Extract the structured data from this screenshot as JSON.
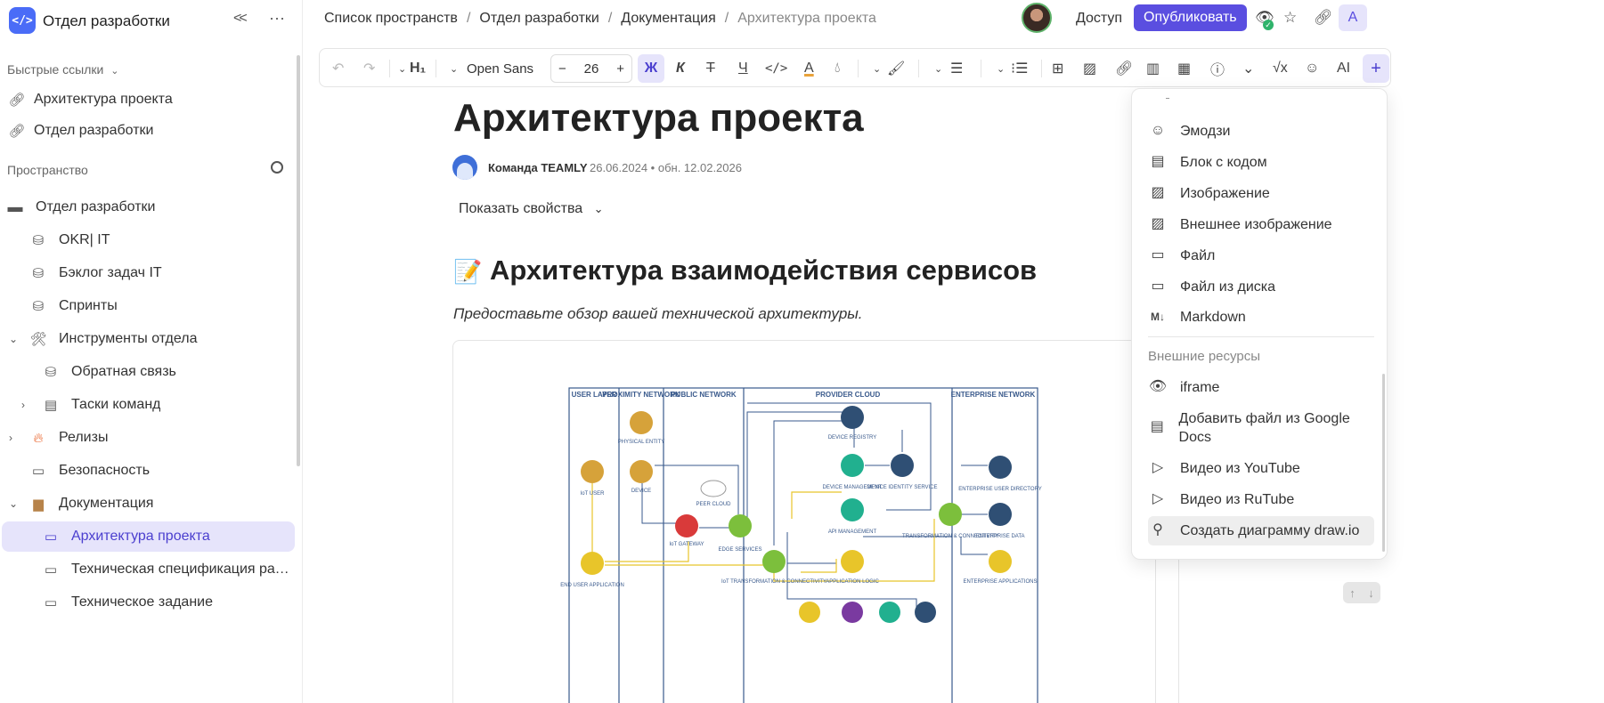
{
  "sidebar": {
    "workspace_title": "Отдел разработки",
    "logo_text": "</>",
    "quick_links_label": "Быстрые ссылки",
    "quick_links": [
      {
        "label": "Архитектура проекта",
        "icon": "link-icon"
      },
      {
        "label": "Отдел разработки",
        "icon": "link-icon"
      }
    ],
    "space_label": "Пространство",
    "tree": [
      {
        "label": "Отдел разработки",
        "icon": "folder-icon",
        "level": 0
      },
      {
        "label": "OKR| IT",
        "icon": "database-icon",
        "level": 1
      },
      {
        "label": "Бэклог задач IT",
        "icon": "database-icon",
        "level": 1
      },
      {
        "label": "Спринты",
        "icon": "database-icon",
        "level": 1
      },
      {
        "label": "Инструменты отдела",
        "icon": "tools-emoji",
        "level": 1,
        "expanded": true
      },
      {
        "label": "Обратная связь",
        "icon": "database-icon",
        "level": 2
      },
      {
        "label": "Таски команд",
        "icon": "page-emoji",
        "level": 2,
        "collapsed": true
      },
      {
        "label": "Релизы",
        "icon": "fire-emoji",
        "level": 1,
        "collapsed": true
      },
      {
        "label": "Безопасность",
        "icon": "document-icon",
        "level": 1
      },
      {
        "label": "Документация",
        "icon": "box-emoji",
        "level": 1,
        "expanded": true
      },
      {
        "label": "Архитектура проекта",
        "icon": "document-icon",
        "level": 2,
        "active": true
      },
      {
        "label": "Техническая спецификация разр...",
        "icon": "document-icon",
        "level": 2
      },
      {
        "label": "Техническое задание",
        "icon": "document-icon",
        "level": 2
      }
    ]
  },
  "topbar": {
    "breadcrumbs": [
      "Список пространств",
      "Отдел разработки",
      "Документация",
      "Архитектура проекта"
    ],
    "access_label": "Доступ",
    "publish_label": "Опубликовать",
    "user_initial": "A"
  },
  "toolbar": {
    "heading": "H₁",
    "font": "Open Sans",
    "font_size": "26",
    "bold": "Ж",
    "italic": "К",
    "strike": "Т",
    "underline": "Ч",
    "ai": "AI"
  },
  "document": {
    "title": "Архитектура проекта",
    "author": "Команда TEAMLY",
    "dates": "26.06.2024 • обн. 12.02.2026",
    "show_props": "Показать свойства",
    "heading": "Архитектура взаимодействия сервисов",
    "heading_emoji": "📝",
    "subtitle": "Предоставьте обзор вашей технической архитектуры."
  },
  "diagram": {
    "columns": [
      "USER LAYER",
      "PROXIMITY NETWORK",
      "PUBLIC NETWORK",
      "PROVIDER CLOUD",
      "ENTERPRISE NETWORK"
    ],
    "nodes": [
      {
        "id": "physical",
        "label": "PHYSICAL ENTITY",
        "color": "#d6a23a"
      },
      {
        "id": "iot_user",
        "label": "IoT USER",
        "color": "#d6a23a"
      },
      {
        "id": "device",
        "label": "DEVICE",
        "color": "#d6a23a"
      },
      {
        "id": "peer",
        "label": "PEER CLOUD",
        "color": "#ffffff"
      },
      {
        "id": "gateway",
        "label": "IoT GATEWAY",
        "color": "#d93a3a"
      },
      {
        "id": "edge",
        "label": "EDGE SERVICES",
        "color": "#7cbf3c"
      },
      {
        "id": "end_user",
        "label": "END USER APPLICATION",
        "color": "#e8c52a"
      },
      {
        "id": "device_reg",
        "label": "DEVICE REGISTRY",
        "color": "#2f4f74"
      },
      {
        "id": "device_mgmt",
        "label": "DEVICE MANAGEMENT",
        "color": "#21b08f"
      },
      {
        "id": "device_id",
        "label": "DEVICE IDENTITY SERVICE",
        "color": "#2f4f74"
      },
      {
        "id": "api",
        "label": "API MANAGEMENT",
        "color": "#21b08f"
      },
      {
        "id": "iot_transform",
        "label": "IoT TRANSFORMATION & CONNECTIVITY",
        "color": "#7cbf3c"
      },
      {
        "id": "app_logic",
        "label": "APPLICATION LOGIC",
        "color": "#e8c52a"
      },
      {
        "id": "ent_transform",
        "label": "TRANSFORMATION & CONNECTIVITY",
        "color": "#7cbf3c"
      },
      {
        "id": "ent_user_dir",
        "label": "ENTERPRISE USER DIRECTORY",
        "color": "#2f4f74"
      },
      {
        "id": "ent_data",
        "label": "ENTERPRISE DATA",
        "color": "#2f4f74"
      },
      {
        "id": "ent_apps",
        "label": "ENTERPRISE APPLICATIONS",
        "color": "#e8c52a"
      }
    ]
  },
  "insert_menu": {
    "items": [
      {
        "label": "Эмодзи",
        "icon": "smile-icon"
      },
      {
        "label": "Блок с кодом",
        "icon": "code-block-icon"
      },
      {
        "label": "Изображение",
        "icon": "image-icon"
      },
      {
        "label": "Внешнее изображение",
        "icon": "image-icon"
      },
      {
        "label": "Файл",
        "icon": "folder-icon"
      },
      {
        "label": "Файл из диска",
        "icon": "folder-icon"
      },
      {
        "label": "Markdown",
        "icon": "markdown-icon"
      }
    ],
    "external_label": "Внешние ресурсы",
    "external_items": [
      {
        "label": "iframe",
        "icon": "eye-icon"
      },
      {
        "label": "Добавить файл из Google Docs",
        "icon": "google-docs-icon"
      },
      {
        "label": "Видео из YouTube",
        "icon": "play-icon"
      },
      {
        "label": "Видео из RuTube",
        "icon": "play-icon"
      },
      {
        "label": "Создать диаграмму draw.io",
        "icon": "drawio-icon",
        "highlighted": true
      }
    ]
  },
  "colors": {
    "accent": "#5a4ee0",
    "accent_light": "#e6e4fb",
    "diagram_border": "#3a5a8c"
  }
}
